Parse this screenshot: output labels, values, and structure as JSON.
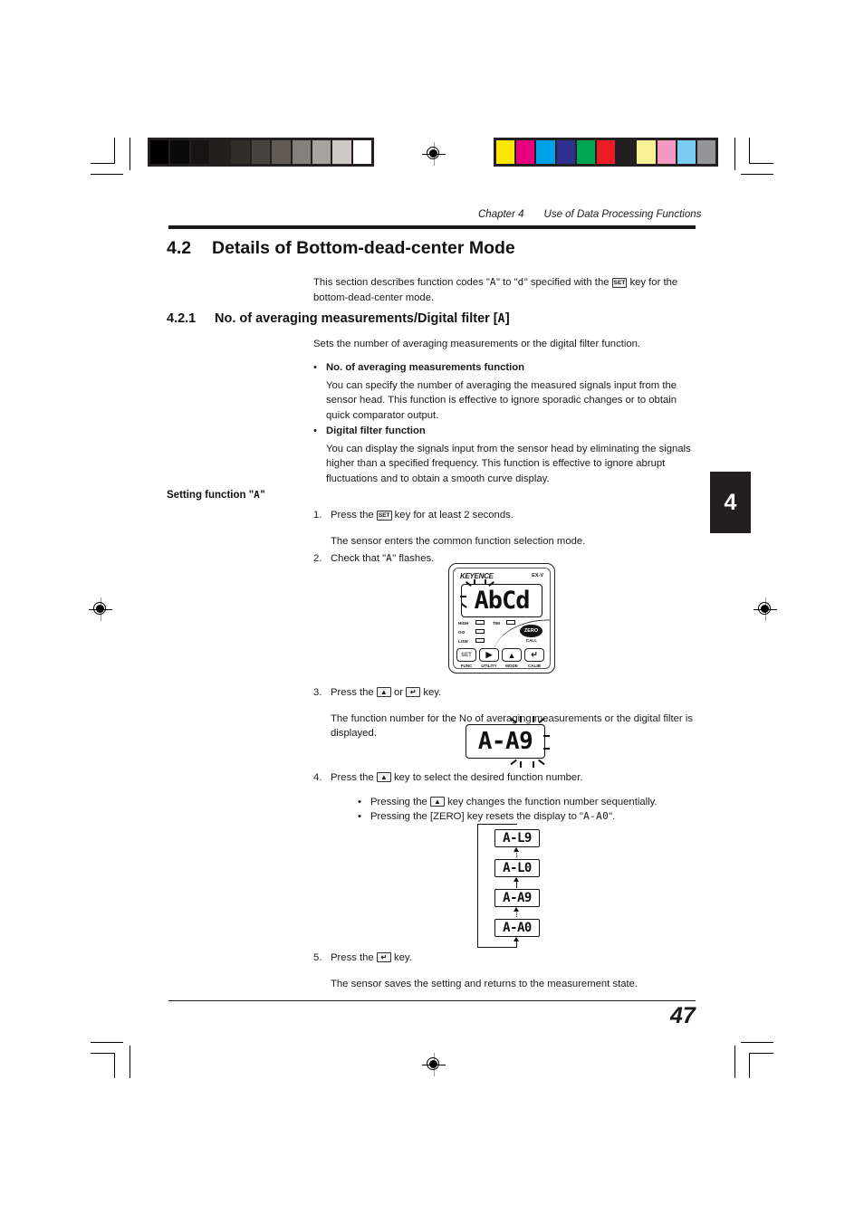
{
  "header": {
    "chapter": "Chapter 4",
    "title": "Use of Data Processing Functions",
    "chapter_tab": "4"
  },
  "section": {
    "number": "4.2",
    "title": "Details of Bottom-dead-center Mode",
    "intro_part1": "This section describes function codes \"",
    "intro_code_a": "A",
    "intro_part2": "\" to \"",
    "intro_code_d": "d",
    "intro_part3": "\" specified with the ",
    "intro_key": "SET",
    "intro_part4": " key for the bottom-dead-center mode."
  },
  "subsection": {
    "number": "4.2.1",
    "title_main": "No. of averaging measurements/Digital filter [",
    "title_code": "A",
    "title_tail": "]",
    "lead": "Sets the number of averaging measurements or the digital filter function.",
    "bullets": [
      {
        "dot": "•",
        "heading": "No. of averaging measurements function",
        "body": "You can specify the number of averaging the measured signals input from the sensor head. This function is effective to ignore sporadic changes or to obtain quick comparator output."
      },
      {
        "dot": "•",
        "heading": "Digital filter function",
        "body": "You can display the signals input from the sensor head by eliminating the signals higher than a specified frequency. This function is effective to ignore abrupt fluctuations and to obtain a smooth curve display."
      }
    ]
  },
  "procedure": {
    "side_label_prefix": "Setting function \"",
    "side_label_code": "A",
    "side_label_suffix": "\"",
    "steps": [
      {
        "num": "1.",
        "text_pre": "Press the ",
        "key": "SET",
        "text_post": " key for at least 2 seconds.",
        "result": "The sensor enters the common function selection mode."
      },
      {
        "num": "2.",
        "text_pre": "Check that \"",
        "code": "A",
        "text_post": "\" flashes."
      },
      {
        "num": "3.",
        "text_pre": "Press the ",
        "key1": "▲",
        "text_mid": " or ",
        "key2": "↵",
        "text_post": " key.",
        "result": "The function number for the No of averaging measurements or the digital filter is displayed."
      },
      {
        "num": "4.",
        "text_pre": "Press the ",
        "key": "▲",
        "text_post": " key to select the desired function number.",
        "sub_bullets": [
          {
            "dot": "•",
            "text_pre": "Pressing the ",
            "key": "▲",
            "text_post": " key changes the function number sequentially."
          },
          {
            "dot": "•",
            "text_pre": "Pressing the [ZERO] key resets the display to \"",
            "code": "A-A0",
            "text_post": "\"."
          }
        ]
      },
      {
        "num": "5.",
        "text_pre": "Press the ",
        "key": "↵",
        "text_post": " key.",
        "result": "The sensor saves the setting and returns to the measurement state."
      }
    ]
  },
  "sensor_unit": {
    "brand": "KEYENCE",
    "model": "EX-V",
    "display": "AbCd",
    "indicators": [
      "HIGH",
      "GO",
      "LOW",
      "TIM"
    ],
    "zero_button": "ZERO",
    "call_label": "CALL",
    "buttons": [
      {
        "face": "SET",
        "label": "FUNC"
      },
      {
        "face": "▶",
        "label": "UTILITY"
      },
      {
        "face": "▲",
        "label": "MODE"
      },
      {
        "face": "↵",
        "label": "CALIB"
      }
    ]
  },
  "displays": {
    "step3_readout": "A-A9",
    "sequence": [
      "A-L9",
      "A-L0",
      "A-A9",
      "A-A0"
    ]
  },
  "footer": {
    "page_number": "47"
  },
  "calibration": {
    "grayscale": [
      "#000000",
      "#0b0a0a",
      "#171413",
      "#241f1d",
      "#332d2a",
      "#4a423e",
      "#635953",
      "#86807c",
      "#a9a29e",
      "#cfc8c4",
      "#ffffff"
    ],
    "colorbar": [
      "#ffe800",
      "#e6007e",
      "#00a0e9",
      "#2e3192",
      "#00a651",
      "#ed1c24",
      "#231f20",
      "#faf096",
      "#f49ac1",
      "#7accf5",
      "#939598"
    ]
  }
}
